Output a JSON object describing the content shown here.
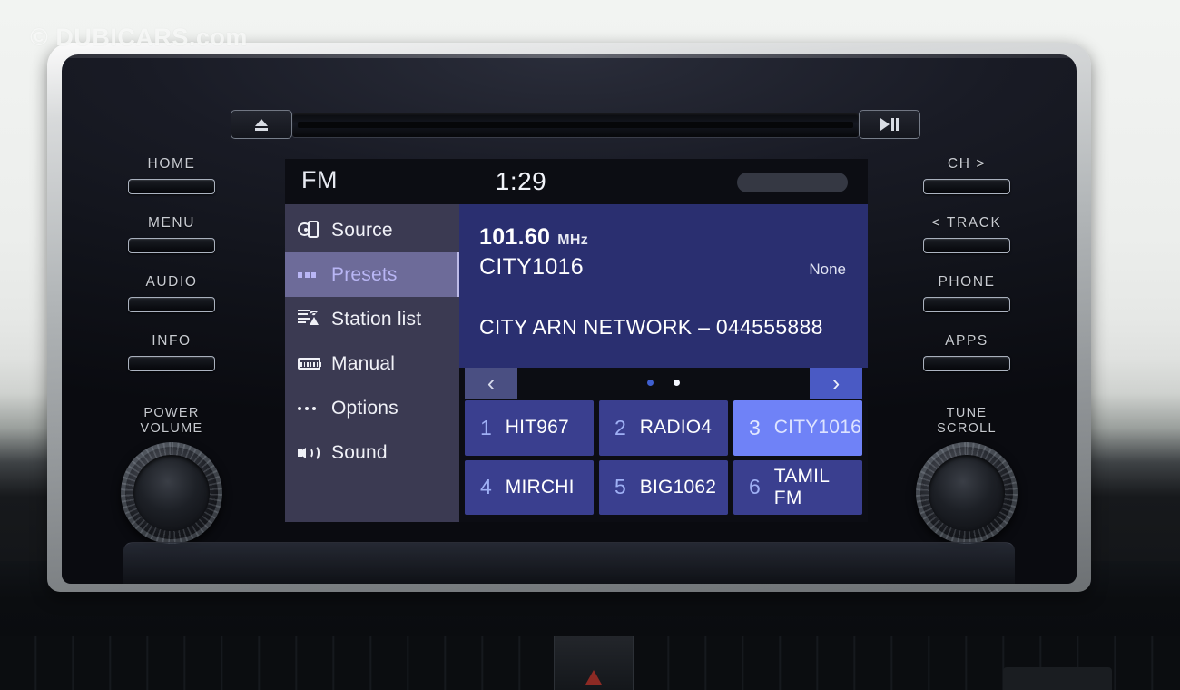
{
  "watermark": "© DUBICARS.com",
  "head_unit": {
    "transport": {
      "eject_icon": "eject-icon",
      "play_pause_icon": "play-pause-icon"
    },
    "left_buttons": [
      {
        "label": "HOME"
      },
      {
        "label": "MENU"
      },
      {
        "label": "AUDIO"
      },
      {
        "label": "INFO"
      }
    ],
    "right_buttons": [
      {
        "label": "CH  >"
      },
      {
        "label": "< TRACK"
      },
      {
        "label": "PHONE"
      },
      {
        "label": "APPS"
      }
    ],
    "left_knob": {
      "line1": "POWER",
      "line2": "VOLUME"
    },
    "right_knob": {
      "line1": "TUNE",
      "line2": "SCROLL"
    }
  },
  "screen": {
    "status": {
      "band": "FM",
      "clock": "1:29"
    },
    "sidebar": {
      "items": [
        {
          "label": "Source",
          "icon": "source-icon",
          "active": false
        },
        {
          "label": "Presets",
          "icon": "presets-icon",
          "active": true
        },
        {
          "label": "Station list",
          "icon": "station-list-icon",
          "active": false
        },
        {
          "label": "Manual",
          "icon": "manual-icon",
          "active": false
        },
        {
          "label": "Options",
          "icon": "options-icon",
          "active": false
        },
        {
          "label": "Sound",
          "icon": "sound-icon",
          "active": false
        }
      ]
    },
    "info": {
      "frequency": "101.60",
      "unit": "MHz",
      "station": "CITY1016",
      "rds_status": "None",
      "radio_text": "CITY ARN NETWORK – 044555888"
    },
    "nav": {
      "prev_icon": "chevron-left-icon",
      "next_icon": "chevron-right-icon",
      "page_count": 2,
      "active_page": 2
    },
    "presets": [
      {
        "number": "1",
        "name": "HIT967",
        "selected": false
      },
      {
        "number": "2",
        "name": "RADIO4",
        "selected": false
      },
      {
        "number": "3",
        "name": "CITY1016",
        "selected": true
      },
      {
        "number": "4",
        "name": "MIRCHI",
        "selected": false
      },
      {
        "number": "5",
        "name": "BIG1062",
        "selected": false
      },
      {
        "number": "6",
        "name": "TAMIL FM",
        "selected": false
      }
    ]
  },
  "colors": {
    "accent_blue": "#6f82f7",
    "preset_blue": "#3a3f8f",
    "info_panel": "#2a2f70",
    "sidebar": "#3b3a52",
    "sidebar_active": "#6d6b99"
  }
}
